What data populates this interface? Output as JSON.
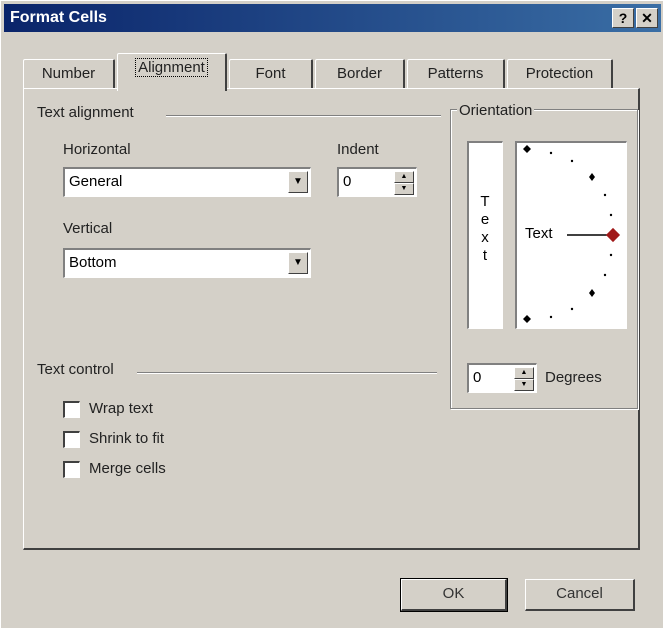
{
  "window": {
    "title": "Format Cells",
    "help_glyph": "?",
    "close_glyph": "✕"
  },
  "tabs": [
    {
      "label": "Number"
    },
    {
      "label": "Alignment"
    },
    {
      "label": "Font"
    },
    {
      "label": "Border"
    },
    {
      "label": "Patterns"
    },
    {
      "label": "Protection"
    }
  ],
  "active_tab": "Alignment",
  "text_alignment": {
    "group_label": "Text alignment",
    "horizontal": {
      "label": "Horizontal",
      "value": "General"
    },
    "indent": {
      "label": "Indent",
      "value": "0"
    },
    "vertical": {
      "label": "Vertical",
      "value": "Bottom"
    }
  },
  "text_control": {
    "group_label": "Text control",
    "wrap_text": {
      "label": "Wrap text",
      "checked": false
    },
    "shrink_to_fit": {
      "label": "Shrink to fit",
      "checked": false
    },
    "merge_cells": {
      "label": "Merge cells",
      "checked": false
    }
  },
  "orientation": {
    "group_label": "Orientation",
    "vertical_text": [
      "T",
      "e",
      "x",
      "t"
    ],
    "dial_text": "Text",
    "degrees_value": "0",
    "degrees_label": "Degrees",
    "indicator_color": "#a01818"
  },
  "buttons": {
    "ok": "OK",
    "cancel": "Cancel"
  }
}
